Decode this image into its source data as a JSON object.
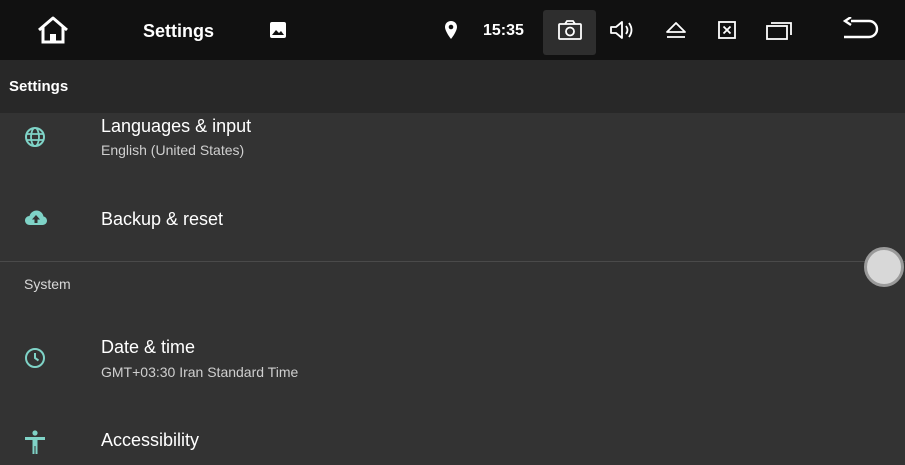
{
  "statusbar": {
    "title": "Settings",
    "time": "15:35",
    "icons": [
      "home-icon",
      "image-icon",
      "location-icon",
      "camera-icon",
      "volume-icon",
      "eject-icon",
      "close-box-icon",
      "recent-apps-icon",
      "back-icon"
    ]
  },
  "subheader": {
    "title": "Settings"
  },
  "rows": [
    {
      "icon": "globe-icon",
      "title": "Languages & input",
      "subtitle": "English (United States)"
    },
    {
      "icon": "cloud-upload-icon",
      "title": "Backup & reset"
    },
    {
      "icon": "clock-icon",
      "title": "Date & time",
      "subtitle": "GMT+03:30 Iran Standard Time"
    },
    {
      "icon": "accessibility-icon",
      "title": "Accessibility"
    }
  ],
  "sections": {
    "system": "System"
  },
  "colors": {
    "accent": "#7fd3c7",
    "statusbar": "#111111",
    "background": "#333333"
  }
}
